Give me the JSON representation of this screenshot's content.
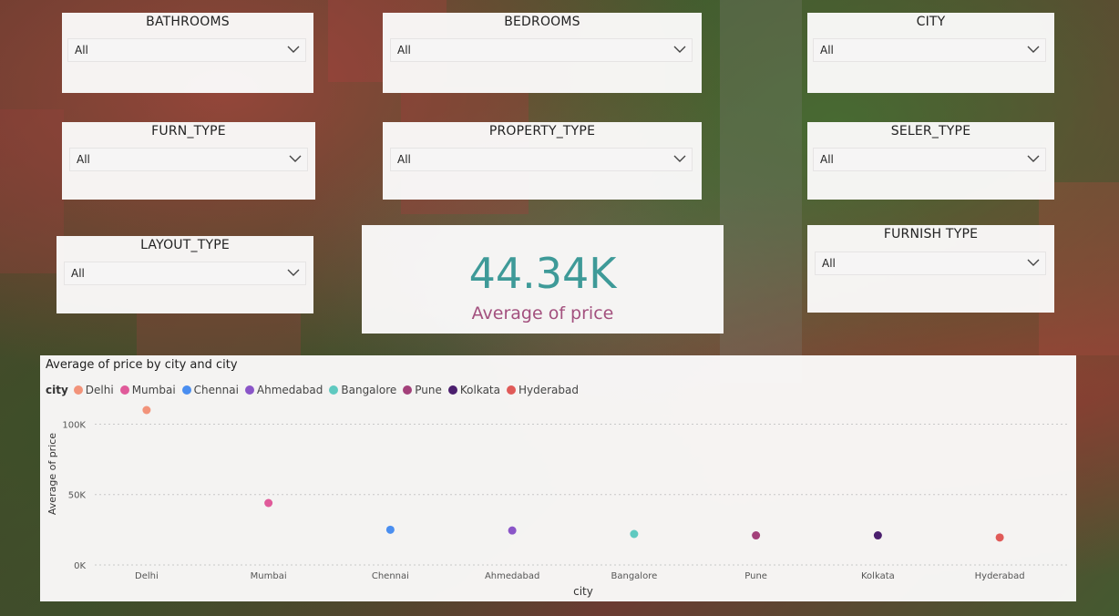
{
  "slicers": {
    "bathrooms": {
      "title": "BATHROOMS",
      "value": "All"
    },
    "bedrooms": {
      "title": "BEDROOMS",
      "value": "All"
    },
    "city": {
      "title": "CITY",
      "value": "All"
    },
    "furn_type": {
      "title": "FURN_TYPE",
      "value": "All"
    },
    "property_type": {
      "title": "PROPERTY_TYPE",
      "value": "All"
    },
    "seler_type": {
      "title": "SELER_TYPE",
      "value": "All"
    },
    "layout_type": {
      "title": "LAYOUT_TYPE",
      "value": "All"
    },
    "furnish_type": {
      "title": "FURNISH TYPE",
      "value": "All"
    }
  },
  "kpi": {
    "value": "44.34K",
    "label": "Average of price",
    "value_color": "#3e9a98",
    "label_color": "#a3507e"
  },
  "chart": {
    "title": "Average of price by city and city",
    "legend_title": "city"
  },
  "chart_data": {
    "type": "scatter",
    "title": "Average of price by city and city",
    "xlabel": "city",
    "ylabel": "Average of price",
    "ylim": [
      0,
      110000
    ],
    "yticks": [
      "0K",
      "50K",
      "100K"
    ],
    "ytick_values": [
      0,
      50000,
      100000
    ],
    "grid": true,
    "legend_placement": "top-left",
    "categories": [
      "Delhi",
      "Mumbai",
      "Chennai",
      "Ahmedabad",
      "Bangalore",
      "Pune",
      "Kolkata",
      "Hyderabad"
    ],
    "values": [
      110000,
      44000,
      25000,
      24500,
      22000,
      21000,
      21000,
      19500
    ],
    "colors": [
      "#f2937a",
      "#e05a9a",
      "#4a8ef0",
      "#8a55c8",
      "#5fc9c0",
      "#a3407a",
      "#4b1f6e",
      "#e05a58"
    ]
  }
}
